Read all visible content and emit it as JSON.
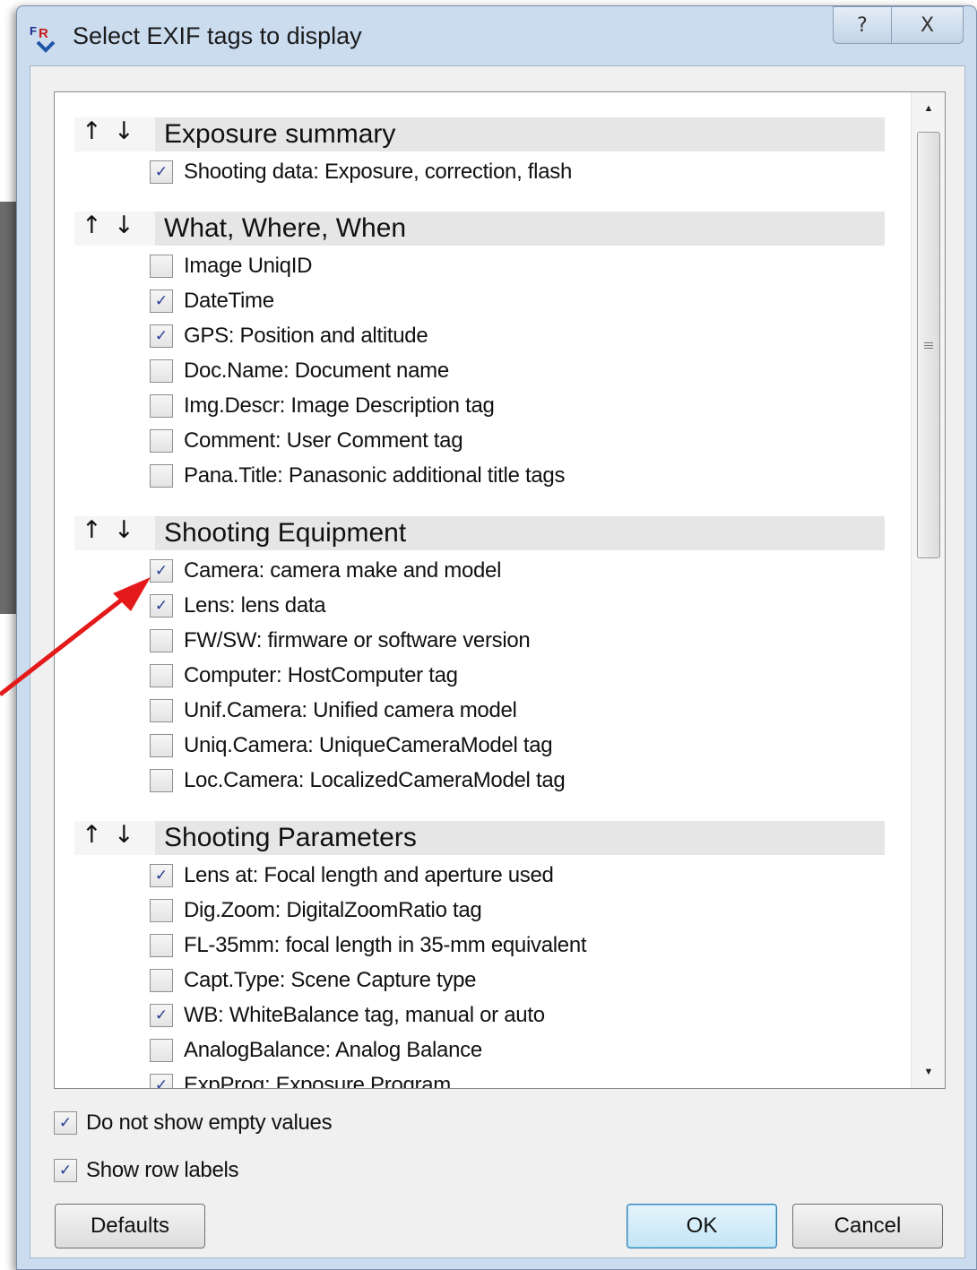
{
  "window": {
    "title": "Select EXIF tags to display",
    "help_label": "?",
    "close_label": "X"
  },
  "arrows": {
    "up": "↑",
    "down": "↓"
  },
  "sections": [
    {
      "title": "Exposure summary",
      "items": [
        {
          "label": "Shooting data: Exposure, correction, flash",
          "checked": true
        }
      ]
    },
    {
      "title": "What, Where, When",
      "items": [
        {
          "label": "Image UniqID",
          "checked": false
        },
        {
          "label": "DateTime",
          "checked": true
        },
        {
          "label": "GPS: Position and altitude",
          "checked": true
        },
        {
          "label": "Doc.Name: Document name",
          "checked": false
        },
        {
          "label": "Img.Descr: Image Description tag",
          "checked": false
        },
        {
          "label": "Comment: User Comment tag",
          "checked": false
        },
        {
          "label": "Pana.Title: Panasonic additional title tags",
          "checked": false
        }
      ]
    },
    {
      "title": "Shooting Equipment",
      "items": [
        {
          "label": "Camera: camera make and model",
          "checked": true
        },
        {
          "label": "Lens: lens data",
          "checked": true
        },
        {
          "label": "FW/SW: firmware or software version",
          "checked": false
        },
        {
          "label": "Computer: HostComputer tag",
          "checked": false
        },
        {
          "label": "Unif.Camera: Unified camera model",
          "checked": false
        },
        {
          "label": "Uniq.Camera: UniqueCameraModel tag",
          "checked": false
        },
        {
          "label": "Loc.Camera: LocalizedCameraModel tag",
          "checked": false
        }
      ]
    },
    {
      "title": "Shooting Parameters",
      "items": [
        {
          "label": "Lens at: Focal length and aperture used",
          "checked": true
        },
        {
          "label": "Dig.Zoom: DigitalZoomRatio tag",
          "checked": false
        },
        {
          "label": "FL-35mm: focal length in 35-mm equivalent",
          "checked": false
        },
        {
          "label": "Capt.Type: Scene Capture type",
          "checked": false
        },
        {
          "label": "WB: WhiteBalance tag, manual or auto",
          "checked": true
        },
        {
          "label": "AnalogBalance: Analog Balance",
          "checked": false
        },
        {
          "label": "ExpProg: Exposure Program",
          "checked": true
        }
      ]
    }
  ],
  "options": {
    "hide_empty": {
      "label": "Do not show empty values",
      "checked": true
    },
    "row_labels": {
      "label": "Show row labels",
      "checked": true
    }
  },
  "buttons": {
    "defaults": "Defaults",
    "ok": "OK",
    "cancel": "Cancel"
  },
  "check_glyph": "✓",
  "colors": {
    "title_bar": "#cbdcef",
    "check": "#243b8e",
    "section_header": "#e6e6e6",
    "callout_arrow": "#e41a1a",
    "default_button": "#c4e5f6"
  }
}
